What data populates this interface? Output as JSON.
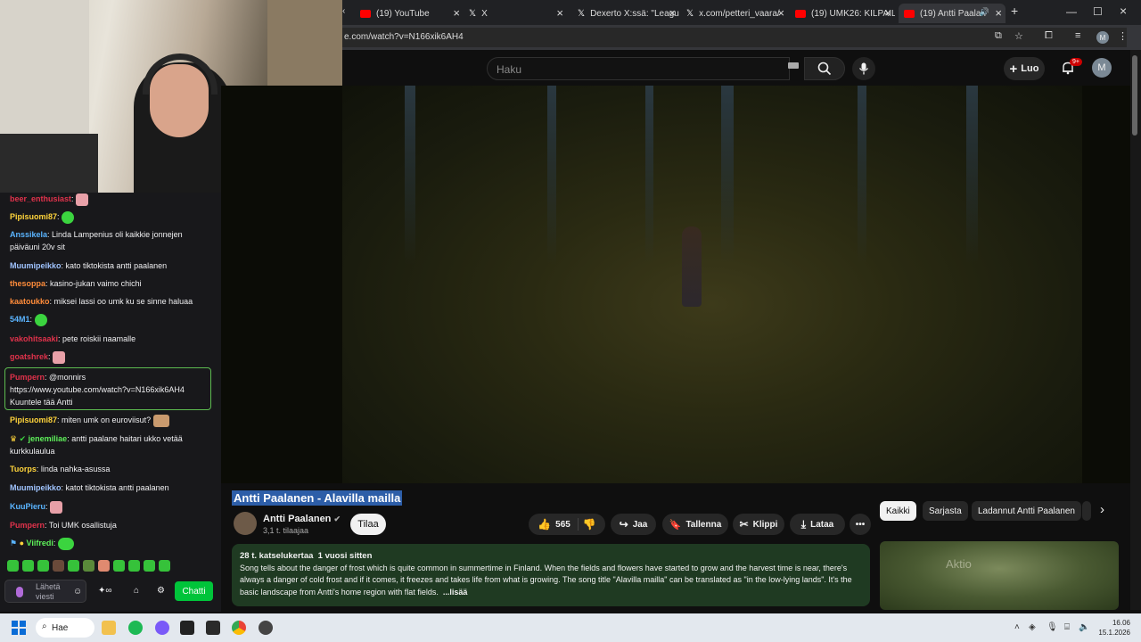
{
  "browser": {
    "tabs": [
      {
        "title": "(19) YouTube",
        "icon": "youtube-icon"
      },
      {
        "title": "X",
        "icon": "x-icon"
      },
      {
        "title": "Dexerto X:ssä: \"Leagu",
        "icon": "x-icon"
      },
      {
        "title": "x.com/petteri_vaara/",
        "icon": "x-icon"
      },
      {
        "title": "(19) UMK26: KILPAILU",
        "icon": "youtube-icon"
      },
      {
        "title": "(19) Antti Paalan",
        "icon": "youtube-icon"
      }
    ],
    "url": "e.com/watch?v=N166xik6AH4",
    "profile_initial": "M"
  },
  "youtube": {
    "search_placeholder": "Haku",
    "create_label": "Luo",
    "notifications_badge": "9+",
    "avatar_initial": "M",
    "video": {
      "title": "Antti Paalanen - Alavilla mailla",
      "channel": "Antti Paalanen",
      "subscribers": "3,1 t. tilaajaa",
      "subscribe_label": "Tilaa",
      "likes": "565",
      "share_label": "Jaa",
      "save_label": "Tallenna",
      "clip_label": "Klippi",
      "download_label": "Lataa",
      "views": "28 t. katselukertaa",
      "age": "1 vuosi sitten",
      "description": "Song tells about the danger of frost which is quite common in summertime in Finland. When the fields and flowers have started to grow and the harvest time is near, there's always a danger of cold frost and if it comes, it freezes and takes life from what is growing. The song title \"Alavilla mailla\" can be translated as \"in the low-lying lands\". It's the basic landscape from Antti's home region with flat fields.",
      "more_label": "...lisää"
    },
    "chips": [
      "Kaikki",
      "Sarjasta",
      "Ladannut Antti Paalanen"
    ],
    "next_thumb_text": "Aktio"
  },
  "chat": {
    "messages": [
      {
        "user": "beer_enthusiast",
        "color": "#e0324b",
        "text": ""
      },
      {
        "user": "Pipisuomi87",
        "color": "#ffd43b",
        "text": ""
      },
      {
        "user": "Anssikela",
        "color": "#5ab4ff",
        "text": "Linda Lampenius oli kaikkie jonnejen päiväuni 20v sit"
      },
      {
        "user": "Muumipeikko",
        "color": "#a0c4ff",
        "text": "kato tiktokista antti paalanen"
      },
      {
        "user": "thesoppa",
        "color": "#ff8c3a",
        "text": "kasino-jukan vaimo chichi"
      },
      {
        "user": "kaatoukko",
        "color": "#ff8c3a",
        "text": "miksei lassi oo umk ku se sinne haluaa"
      },
      {
        "user": "54M1",
        "color": "#5ab4ff",
        "text": ""
      },
      {
        "user": "vakohitsaaki",
        "color": "#e0324b",
        "text": "pete roiskii naamalle"
      },
      {
        "user": "goatshrek",
        "color": "#e0324b",
        "text": ""
      },
      {
        "user": "Pumpern",
        "color": "#e0324b",
        "text": "@monnirs",
        "link": "https://www.youtube.com/watch?v=N166xik6AH4",
        "extra": "Kuuntele tää Antti"
      },
      {
        "user": "Pipisuomi87",
        "color": "#ffd43b",
        "text": "miten umk on euroviisut?"
      },
      {
        "user": "jenemiliae",
        "color": "#5ef05a",
        "text": "antti paalane haitari ukko vetää kurkkulaulua"
      },
      {
        "user": "Tuorps",
        "color": "#ffd43b",
        "text": "linda nahka-asussa"
      },
      {
        "user": "Muumipeikko",
        "color": "#a0c4ff",
        "text": "katot tiktokista antti paalanen"
      },
      {
        "user": "KuuPieru",
        "color": "#5ab4ff",
        "text": ""
      },
      {
        "user": "Pumpern",
        "color": "#e0324b",
        "text": "Toi UMK osallistuja"
      },
      {
        "user": "Viifredi",
        "color": "#5ef05a",
        "text": ""
      }
    ],
    "input_placeholder": "Lähetä viesti",
    "send_label": "Chatti"
  },
  "taskbar": {
    "search_label": "Hae",
    "time": "16.06",
    "date": "15.1.2026"
  }
}
